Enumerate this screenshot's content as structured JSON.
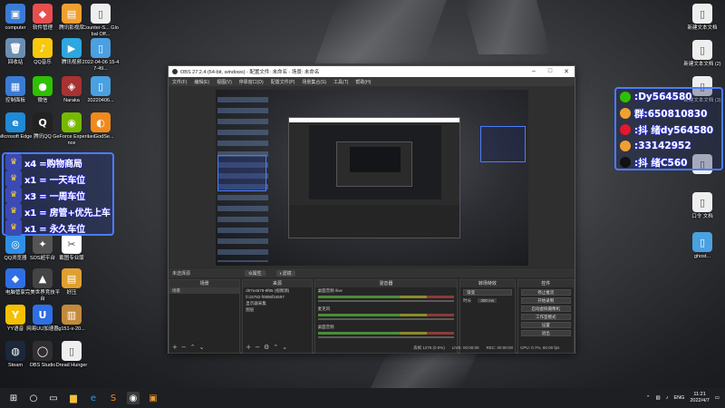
{
  "desktop": {
    "left_icons": [
      {
        "label": "computer",
        "color": "#3a7bd5",
        "glyph": "▣"
      },
      {
        "label": "软件管理",
        "color": "#e94e4e",
        "glyph": "◆"
      },
      {
        "label": "腾讯影视库",
        "color": "#f0a030",
        "glyph": "▤"
      },
      {
        "label": "Counter-S... Global Off...",
        "color": "#eeeeee",
        "glyph": "▯"
      },
      {
        "label": "回收站",
        "color": "#6b8fb3",
        "glyph": "🗑"
      },
      {
        "label": "QQ音乐",
        "color": "#f6c90e",
        "glyph": "♪"
      },
      {
        "label": "腾讯视频",
        "color": "#2ea7e0",
        "glyph": "▶"
      },
      {
        "label": "2022-04-06 15-47-49...",
        "color": "#4aa0e0",
        "glyph": "▯"
      },
      {
        "label": "控制面板",
        "color": "#3a7bd5",
        "glyph": "▦"
      },
      {
        "label": "微信",
        "color": "#2dc100",
        "glyph": "●"
      },
      {
        "label": "Naraka",
        "color": "#a83232",
        "glyph": "◈"
      },
      {
        "label": "20220406...",
        "color": "#4aa0e0",
        "glyph": "▯"
      },
      {
        "label": "Microsoft Edge",
        "color": "#1f8ad6",
        "glyph": "e"
      },
      {
        "label": "腾讯QQ",
        "color": "#222222",
        "glyph": "Q"
      },
      {
        "label": "GeForce Experience",
        "color": "#76b900",
        "glyph": "◉"
      },
      {
        "label": "LeiGodSe...",
        "color": "#f08a1c",
        "glyph": "◐"
      }
    ],
    "left_icons_lower": [
      {
        "label": "QQ浏览器",
        "color": "#2f8fe6",
        "glyph": "◎"
      },
      {
        "label": "SOS超平台",
        "color": "#555555",
        "glyph": "✦"
      },
      {
        "label": "截图专业版",
        "color": "#ffffff",
        "glyph": "✂"
      },
      {
        "label": "电脑管家",
        "color": "#2f6fe6",
        "glyph": "◆"
      },
      {
        "label": "完美世界竞技平台",
        "color": "#444444",
        "glyph": "▲"
      },
      {
        "label": "好压",
        "color": "#e0a030",
        "glyph": "▤"
      },
      {
        "label": "YY语音",
        "color": "#f5c000",
        "glyph": "Y"
      },
      {
        "label": "网易UU加速器",
        "color": "#2f6fe6",
        "glyph": "U"
      },
      {
        "label": "g151-x-20...",
        "color": "#c28a3a",
        "glyph": "▥"
      },
      {
        "label": "Steam",
        "color": "#1b2838",
        "glyph": "◍"
      },
      {
        "label": "OBS Studio",
        "color": "#302e31",
        "glyph": "◯"
      },
      {
        "label": "Dread Hunger",
        "color": "#eeeeee",
        "glyph": "▯"
      }
    ],
    "right_icons": [
      {
        "label": "新建文本文档",
        "color": "#eeeeee",
        "glyph": "▯"
      },
      {
        "label": "新建文本文档 (2)",
        "color": "#eeeeee",
        "glyph": "▯"
      },
      {
        "label": "新建文本文档 (3)",
        "color": "#eeeeee",
        "glyph": "▯"
      },
      {
        "label": "",
        "color": "#eeeeee",
        "glyph": "▯"
      },
      {
        "label": "口令 文档",
        "color": "#eeeeee",
        "glyph": "▯"
      },
      {
        "label": "ghost...",
        "color": "#4aa0e0",
        "glyph": "▯"
      }
    ]
  },
  "banner": {
    "rows": [
      {
        "icon": "crown",
        "text": "x4 =购物商局"
      },
      {
        "icon": "crown",
        "text": "x1 = 一天车位"
      },
      {
        "icon": "crown",
        "text": "x3 = 一周车位"
      },
      {
        "icon": "crown",
        "text": "x1 = 房管+优先上车"
      },
      {
        "icon": "crown",
        "text": "x1 = 永久车位"
      }
    ]
  },
  "contacts": {
    "rows": [
      {
        "icon": "wechat-icon",
        "color": "#2dc100",
        "text": ":Dy564580"
      },
      {
        "icon": "qq-icon",
        "color": "#f0a030",
        "text": "群:650810830"
      },
      {
        "icon": "weibo-icon",
        "color": "#e6162d",
        "text": ":抖 绪dy564580"
      },
      {
        "icon": "qq-icon",
        "color": "#f0a030",
        "text": ":33142952"
      },
      {
        "icon": "douyin-icon",
        "color": "#111111",
        "text": ":抖 绪C560"
      }
    ]
  },
  "obs": {
    "title": "OBS 27.2.4 (64-bit, windows) - 配置文件: 未命名 - 场景: 未命名",
    "menu": [
      "文件(F)",
      "编辑(E)",
      "视图(V)",
      "停靠窗口(D)",
      "配置文件(P)",
      "场景集合(S)",
      "工具(T)",
      "帮助(H)"
    ],
    "toolbar_label": "未选择源",
    "toolbar_props": "⚙属性",
    "toolbar_filters": "◐滤镜",
    "docks": {
      "scenes_title": "场景",
      "scenes": [
        "场景"
      ],
      "sources_title": "来源",
      "sources": [
        "d07e4678-8f85 (视频源)",
        "fc15782-f0896f34597",
        "显示器采集",
        "图层"
      ],
      "mixer_title": "混音器",
      "mixer_tracks": [
        "桌面音频 /live",
        "麦克风",
        "桌面音频"
      ],
      "transitions_title": "转场特效",
      "transition_name": "渐变",
      "duration_label": "时长",
      "duration_value": "300 ms",
      "controls_title": "控件",
      "controls": [
        "停止推流",
        "开始录制",
        "启动虚拟摄像机",
        "工作室模式",
        "设置",
        "退出"
      ]
    },
    "status": {
      "live": "LIVE: 00:00:00",
      "rec": "REC: 00:00:00",
      "cpu": "CPU: 0.7%, 60.00 fps",
      "dropped": "丢帧 1276 (0.0%)"
    }
  },
  "taskbar": {
    "apps": [
      "windows-start-icon",
      "search-icon",
      "taskview-icon",
      "file-explorer-icon",
      "edge-icon",
      "sogou-icon",
      "obs-icon",
      "app-icon"
    ],
    "lang": "ENG",
    "time": "11:21",
    "date": "2022/4/7"
  }
}
